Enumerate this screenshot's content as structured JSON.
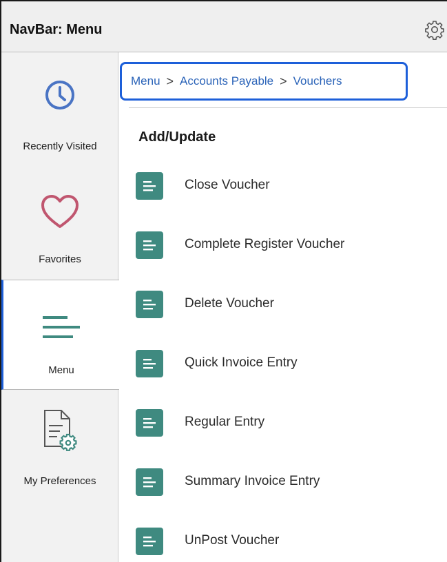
{
  "header": {
    "title": "NavBar: Menu",
    "settings_icon": "gear-icon"
  },
  "sidebar": {
    "items": [
      {
        "label": "Recently Visited",
        "icon": "clock-icon",
        "selected": false
      },
      {
        "label": "Favorites",
        "icon": "heart-icon",
        "selected": false
      },
      {
        "label": "Menu",
        "icon": "menu-lines-icon",
        "selected": true
      },
      {
        "label": "My Preferences",
        "icon": "document-gear-icon",
        "selected": false
      }
    ]
  },
  "breadcrumb": {
    "items": [
      "Menu",
      "Accounts Payable",
      "Vouchers"
    ],
    "separator": ">"
  },
  "section": {
    "title": "Add/Update",
    "items": [
      {
        "label": "Close Voucher"
      },
      {
        "label": "Complete Register Voucher"
      },
      {
        "label": "Delete Voucher"
      },
      {
        "label": "Quick Invoice Entry"
      },
      {
        "label": "Regular Entry"
      },
      {
        "label": "Summary Invoice Entry"
      },
      {
        "label": "UnPost Voucher"
      }
    ]
  },
  "colors": {
    "accent": "#1d5fd9",
    "link": "#2a63b8",
    "tile": "#3f8a80",
    "clock": "#4a74c4",
    "heart": "#c0566f"
  }
}
